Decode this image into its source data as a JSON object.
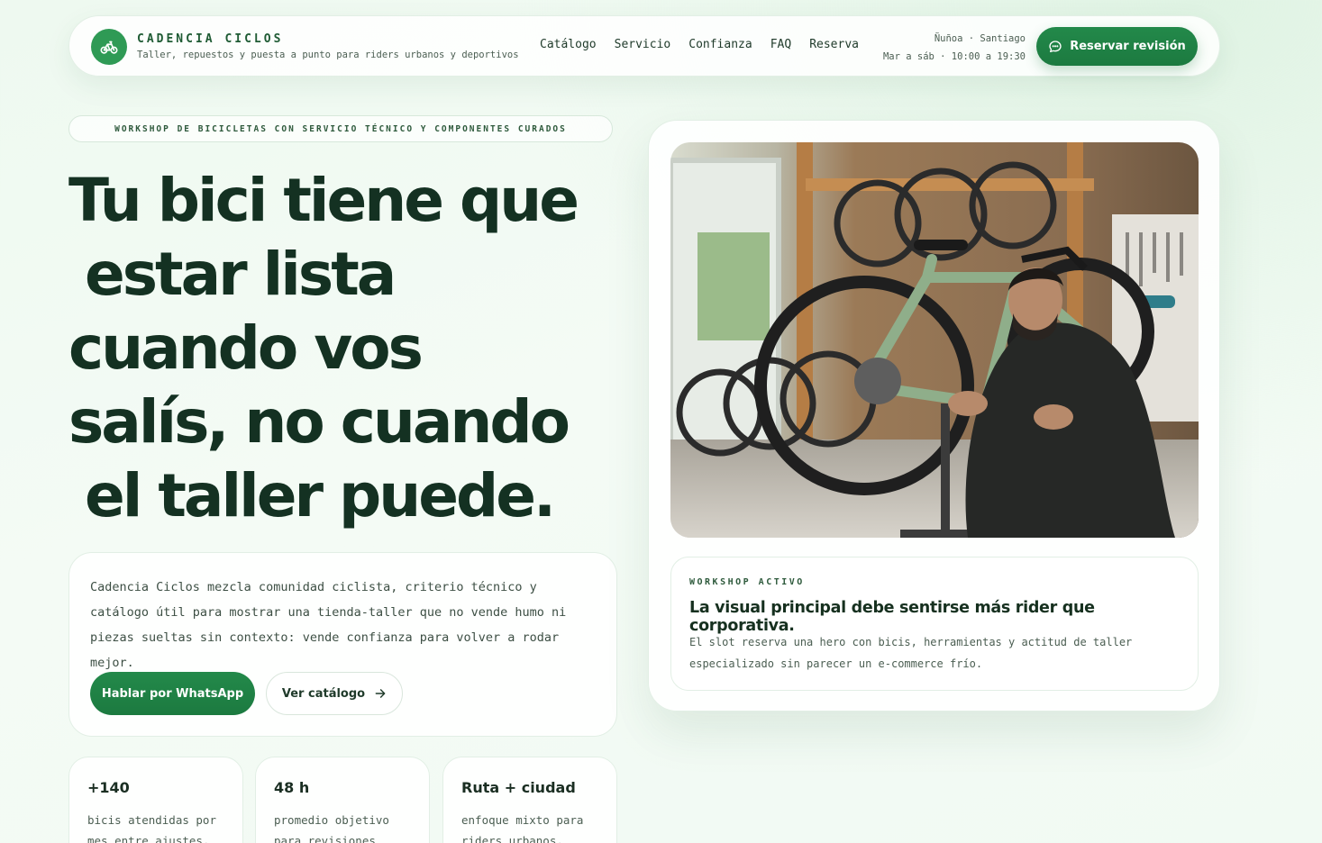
{
  "brand": {
    "name": "CADENCIA CICLOS",
    "tagline": "Taller, repuestos y puesta a punto para riders urbanos y deportivos",
    "logo_icon": "bike-icon"
  },
  "nav": {
    "items": [
      {
        "label": "Catálogo"
      },
      {
        "label": "Servicio"
      },
      {
        "label": "Confianza"
      },
      {
        "label": "FAQ"
      },
      {
        "label": "Reserva"
      }
    ]
  },
  "location": {
    "place": "Ñuñoa · Santiago",
    "hours": "Mar a sáb · 10:00 a 19:30"
  },
  "header_cta": {
    "label": "Reservar revisión",
    "icon": "chat-bubble-icon"
  },
  "hero": {
    "eyebrow": "WORKSHOP DE BICICLETAS CON SERVICIO TÉCNICO Y COMPONENTES CURADOS",
    "headline_lines": [
      "Tu bici tiene que",
      "estar lista",
      "cuando vos",
      "salís, no cuando",
      "el taller puede."
    ],
    "intro": "Cadencia Ciclos mezcla comunidad ciclista, criterio técnico y catálogo útil para mostrar una tienda-taller que no vende humo ni piezas sueltas sin contexto: vende confianza para volver a rodar mejor.",
    "primary_button": "Hablar por WhatsApp",
    "secondary_button": "Ver catálogo",
    "secondary_icon": "arrow-right-icon"
  },
  "stats": [
    {
      "value": "+140",
      "desc": "bicis atendidas por mes entre ajustes,"
    },
    {
      "value": "48 h",
      "desc": "promedio objetivo para revisiones"
    },
    {
      "value": "Ruta + ciudad",
      "desc": "enfoque mixto para riders urbanos, gravel"
    }
  ],
  "showcase": {
    "kicker": "WORKSHOP ACTIVO",
    "title": "La visual principal debe sentirse más rider que corporativa.",
    "body": "El slot reserva una hero con bicis, herramientas y actitud de taller especializado sin parecer un e-commerce frío."
  },
  "colors": {
    "accent": "#1c7a40",
    "accent_light": "#2f9a55",
    "ink": "#143122",
    "background": "#eef9f0"
  }
}
